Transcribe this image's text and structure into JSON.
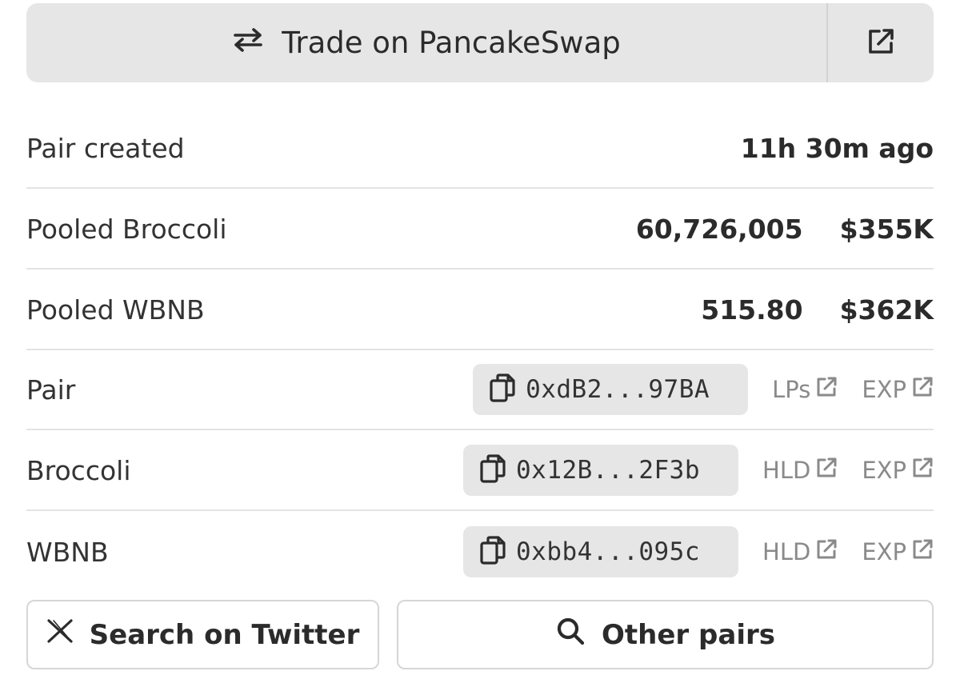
{
  "trade": {
    "label": "Trade on PancakeSwap",
    "swap_icon": "swap-arrows-icon",
    "external_icon": "external-link-icon"
  },
  "info": {
    "pair_created_label": "Pair created",
    "pair_created_value": "11h 30m ago",
    "pooled_token_label": "Pooled Broccoli",
    "pooled_token_amount": "60,726,005",
    "pooled_token_usd": "$355K",
    "pooled_quote_label": "Pooled WBNB",
    "pooled_quote_amount": "515.80",
    "pooled_quote_usd": "$362K"
  },
  "addresses": [
    {
      "label": "Pair",
      "address": "0xdB2...97BA",
      "link1": "LPs",
      "link2": "EXP"
    },
    {
      "label": "Broccoli",
      "address": "0x12B...2F3b",
      "link1": "HLD",
      "link2": "EXP"
    },
    {
      "label": "WBNB",
      "address": "0xbb4...095c",
      "link1": "HLD",
      "link2": "EXP"
    }
  ],
  "buttons": {
    "twitter": "Search on Twitter",
    "other_pairs": "Other pairs"
  },
  "icons": {
    "copy": "copy-icon",
    "x_logo": "x-logo-icon",
    "search": "search-icon"
  },
  "colors": {
    "panel_bg": "#e6e6e6",
    "text": "#2b2b2b",
    "muted": "#8a8a8a",
    "divider": "#e3e3e3"
  }
}
